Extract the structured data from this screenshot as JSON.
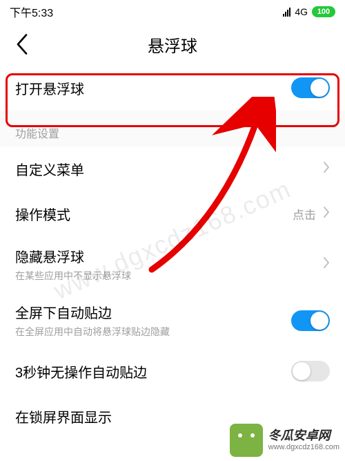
{
  "status": {
    "time": "下午5:33",
    "network": "4G",
    "battery": "100"
  },
  "page": {
    "title": "悬浮球"
  },
  "main_toggle": {
    "label": "打开悬浮球",
    "on": true
  },
  "section_header": "功能设置",
  "rows": {
    "custom_menu": {
      "label": "自定义菜单"
    },
    "mode": {
      "label": "操作模式",
      "value": "点击"
    },
    "hide": {
      "label": "隐藏悬浮球",
      "sub": "在某些应用中不显示悬浮球"
    },
    "fullscreen": {
      "label": "全屏下自动贴边",
      "sub": "在全屏应用中自动将悬浮球贴边隐藏",
      "on": true
    },
    "idle": {
      "label": "3秒钟无操作自动贴边",
      "on": false
    },
    "lockscreen": {
      "label": "在锁屏界面显示"
    }
  },
  "watermark": {
    "diag": "www.dgxcdz168.com",
    "brand": "冬瓜安卓网",
    "url": "www.dgxcdz168.com"
  }
}
